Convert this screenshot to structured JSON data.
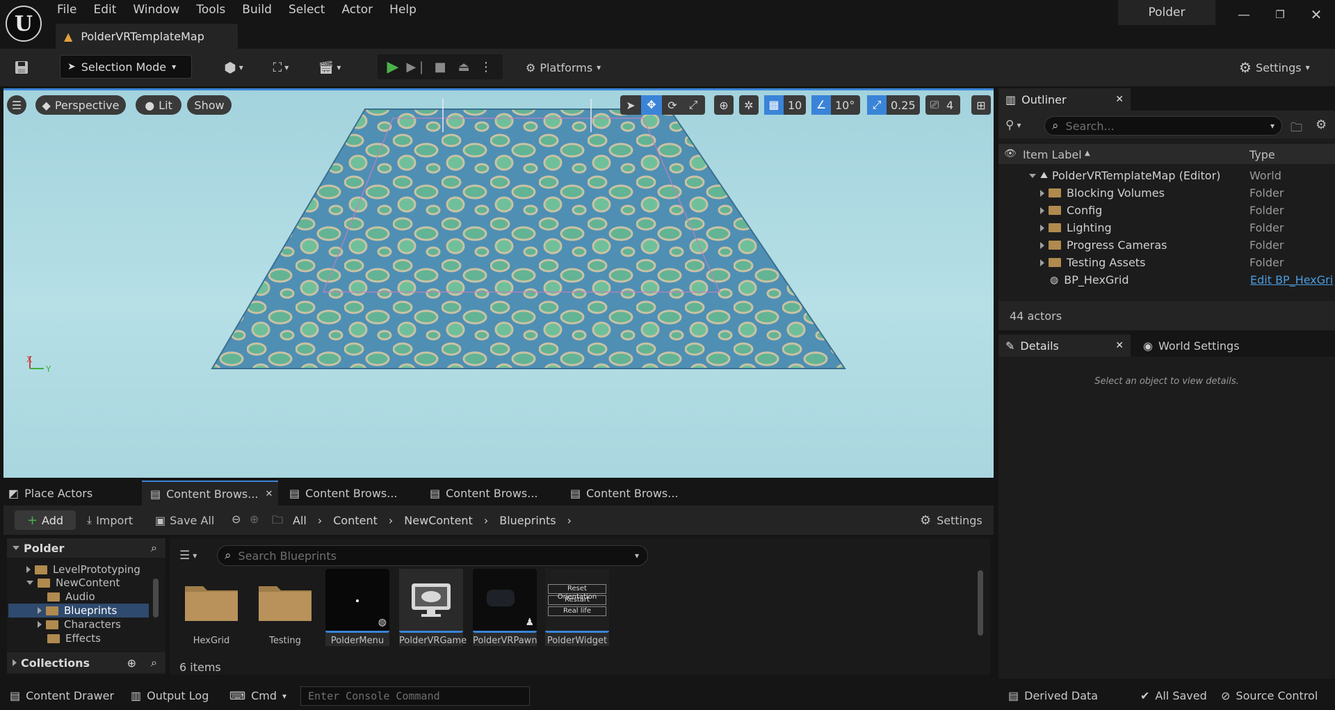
{
  "app": {
    "menu": [
      "File",
      "Edit",
      "Window",
      "Tools",
      "Build",
      "Select",
      "Actor",
      "Help"
    ],
    "map_tab": "PolderVRTemplateMap",
    "project_name": "Polder"
  },
  "toolbar": {
    "selection_mode": "Selection Mode",
    "platforms": "Platforms",
    "settings": "Settings"
  },
  "viewport": {
    "perspective": "Perspective",
    "lit": "Lit",
    "show": "Show",
    "grid_snap": "10",
    "rotation_snap": "10°",
    "scale_snap": "0.25",
    "camera_speed": "4",
    "axis_x": "X",
    "axis_y": "Y"
  },
  "outliner": {
    "title": "Outliner",
    "search_placeholder": "Search...",
    "col_label": "Item Label",
    "col_type": "Type",
    "rows": [
      {
        "label": "PolderVRTemplateMap (Editor)",
        "type": "World"
      },
      {
        "label": "Blocking Volumes",
        "type": "Folder"
      },
      {
        "label": "Config",
        "type": "Folder"
      },
      {
        "label": "Lighting",
        "type": "Folder"
      },
      {
        "label": "Progress Cameras",
        "type": "Folder"
      },
      {
        "label": "Testing Assets",
        "type": "Folder"
      },
      {
        "label": "BP_HexGrid",
        "type": "Edit BP_HexGri"
      }
    ],
    "actor_count": "44 actors"
  },
  "details": {
    "title": "Details",
    "world_settings": "World Settings",
    "empty_msg": "Select an object to view details."
  },
  "content_browser": {
    "tabs": [
      "Place Actors",
      "Content Brows...",
      "Content Brows...",
      "Content Brows...",
      "Content Brows..."
    ],
    "add": "Add",
    "import": "Import",
    "save_all": "Save All",
    "breadcrumb": [
      "All",
      "Content",
      "NewContent",
      "Blueprints"
    ],
    "settings": "Settings",
    "tree_root": "Polder",
    "tree": [
      "LevelPrototyping",
      "NewContent",
      "Audio",
      "Blueprints",
      "Characters",
      "Effects"
    ],
    "collections": "Collections",
    "search_placeholder": "Search Blueprints",
    "assets": [
      "HexGrid",
      "Testing",
      "PolderMenu",
      "PolderVRGame",
      "PolderVRPawn",
      "PolderWidget"
    ],
    "widget_lines": [
      "Reset Orientation",
      "Restart",
      "Real life"
    ],
    "item_count": "6 items"
  },
  "statusbar": {
    "content_drawer": "Content Drawer",
    "output_log": "Output Log",
    "cmd": "Cmd",
    "console_placeholder": "Enter Console Command",
    "derived_data": "Derived Data",
    "all_saved": "All Saved",
    "source_control": "Source Control"
  },
  "colors": {
    "accent_blue": "#3a84d8",
    "play_green": "#4bb34b",
    "folder": "#b08a4e",
    "selected_row": "#2e4a6e",
    "link": "#4d9de0"
  }
}
